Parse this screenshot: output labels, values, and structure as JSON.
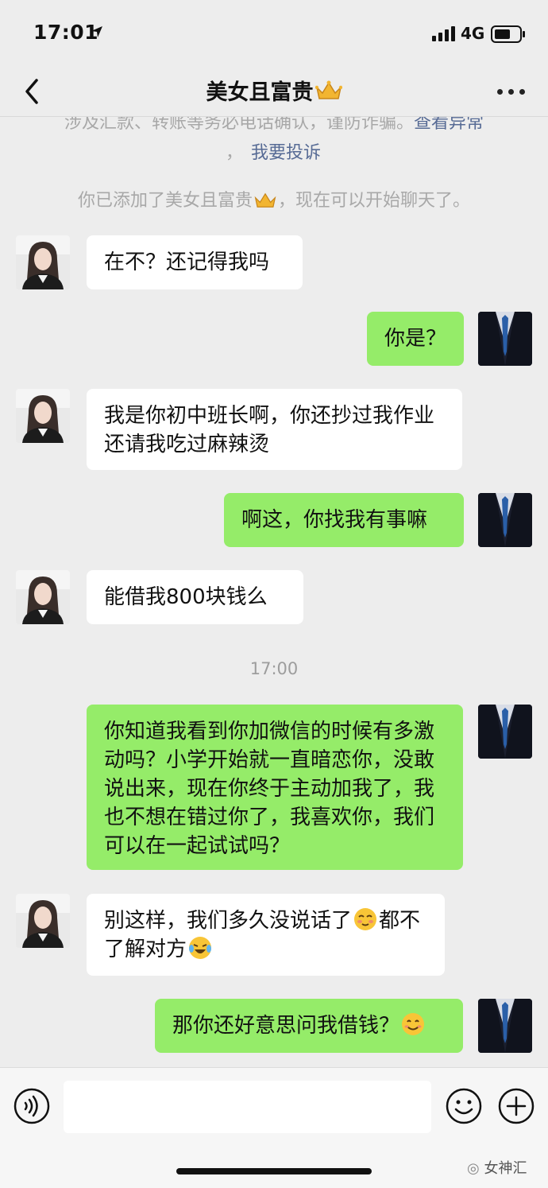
{
  "status_bar": {
    "time": "17:01",
    "network": "4G"
  },
  "nav": {
    "title": "美女且富贵"
  },
  "system_messages": {
    "warning_partial": "涉及汇款、转账等务必电话确认，谨防诈骗。",
    "warning_link": "查看异常",
    "complain_prefix": "，",
    "complain_link": "我要投诉",
    "added_prefix": "你已添加了美女且富贵",
    "added_suffix": "，现在可以开始聊天了。"
  },
  "timestamp": "17:00",
  "messages": [
    {
      "side": "left",
      "text": "在不？还记得我吗"
    },
    {
      "side": "right",
      "text": "你是？"
    },
    {
      "side": "left",
      "text": "我是你初中班长啊，你还抄过我作业还请我吃过麻辣烫"
    },
    {
      "side": "right",
      "text": "啊这，你找我有事嘛"
    },
    {
      "side": "left",
      "text": "能借我800块钱么"
    },
    {
      "side": "right",
      "text": "你知道我看到你加微信的时候有多激动吗？小学开始就一直暗恋你，没敢说出来，现在你终于主动加我了，我也不想在错过你了，我喜欢你，我们可以在一起试试吗？"
    },
    {
      "side": "left",
      "text_a": "别这样，我们多久没说话了",
      "text_b": "都不了解对方"
    },
    {
      "side": "right",
      "text": "那你还好意思问我借钱？"
    }
  ],
  "watermark": "女神汇",
  "colors": {
    "background": "#ededed",
    "sent_bubble": "#95ec69",
    "received_bubble": "#ffffff",
    "link": "#576b95"
  }
}
